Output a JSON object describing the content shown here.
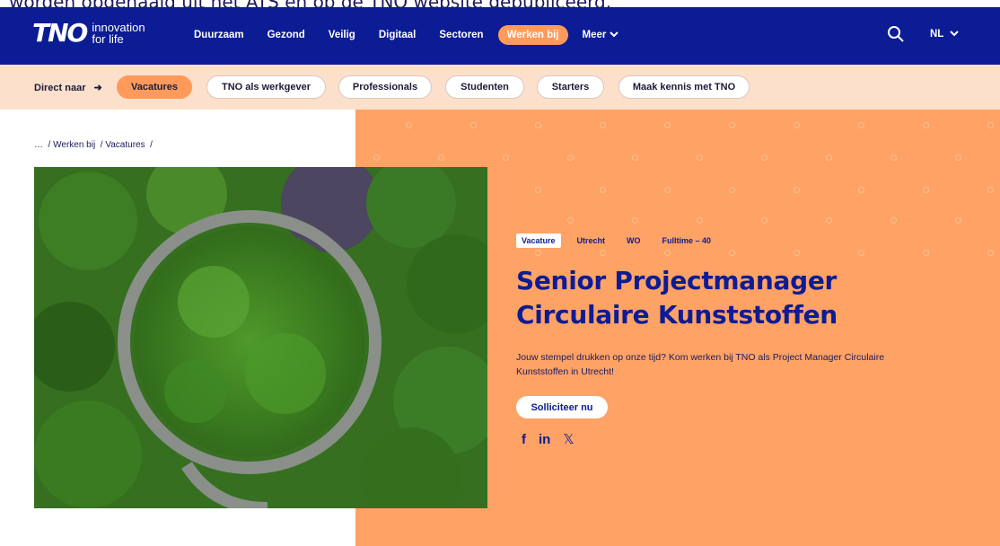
{
  "cut_text": "worden opgehaald uit het ATS en op de TNO website gepubliceerd.",
  "logo": {
    "mark": "TNO",
    "tag_line1": "innovation",
    "tag_line2": "for life"
  },
  "nav": {
    "items": [
      {
        "label": "Duurzaam"
      },
      {
        "label": "Gezond"
      },
      {
        "label": "Veilig"
      },
      {
        "label": "Digitaal"
      },
      {
        "label": "Sectoren"
      },
      {
        "label": "Werken bij"
      },
      {
        "label": "Meer"
      }
    ],
    "lang": "NL"
  },
  "subnav": {
    "label": "Direct naar",
    "pills": [
      {
        "label": "Vacatures"
      },
      {
        "label": "TNO als werkgever"
      },
      {
        "label": "Professionals"
      },
      {
        "label": "Studenten"
      },
      {
        "label": "Starters"
      },
      {
        "label": "Maak kennis met TNO"
      }
    ]
  },
  "breadcrumb": {
    "ellipsis": "…",
    "items": [
      "Werken bij",
      "Vacatures"
    ]
  },
  "job": {
    "tags": [
      "Vacature",
      "Utrecht",
      "WO",
      "Fulltime – 40"
    ],
    "title_line1": "Senior Projectmanager",
    "title_line2": "Circulaire Kunststoffen",
    "description": "Jouw stempel drukken op onze tijd? Kom werken bij TNO als Project Manager Circulaire Kunststoffen in Utrecht!",
    "apply_label": "Solliciteer nu"
  },
  "social": {
    "facebook": "f",
    "linkedin": "in",
    "x": "𝕏"
  },
  "colors": {
    "navy": "#0c1c94",
    "orange": "#ffa266",
    "peach": "#fde0cc",
    "accent": "#ff9a5a"
  }
}
